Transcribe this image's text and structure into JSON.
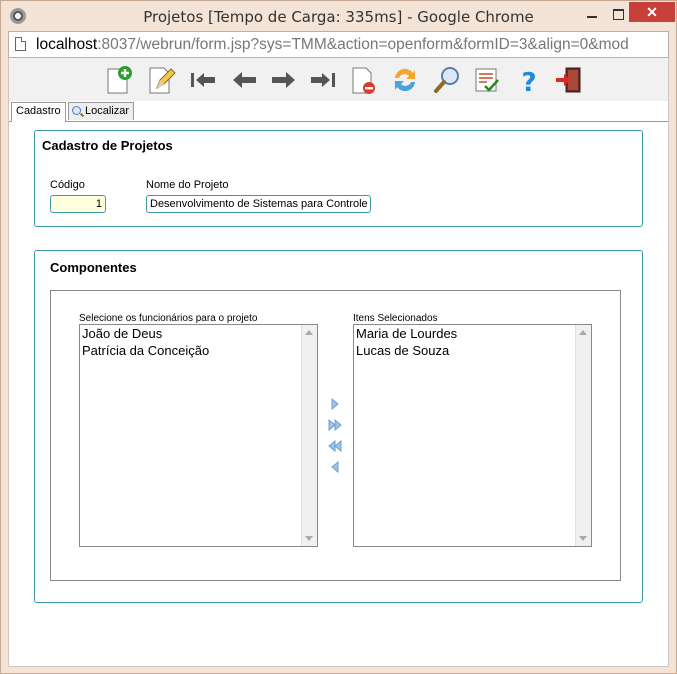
{
  "window": {
    "title": "Projetos [Tempo de Carga: 335ms] - Google Chrome",
    "close_label": "✕"
  },
  "address": {
    "host": "localhost",
    "rest": ":8037/webrun/form.jsp?sys=TMM&action=openform&formID=3&align=0&mod"
  },
  "toolbar": {
    "icons": [
      "new-record-icon",
      "edit-icon",
      "first-record-icon",
      "previous-record-icon",
      "next-record-icon",
      "last-record-icon",
      "delete-icon",
      "refresh-icon",
      "search-icon",
      "report-icon",
      "help-icon",
      "exit-icon"
    ]
  },
  "tabs": {
    "cadastro": "Cadastro",
    "localizar": "Localizar"
  },
  "cadastro": {
    "title": "Cadastro de Projetos",
    "codigo_label": "Código",
    "codigo_value": "1",
    "nome_label": "Nome do Projeto",
    "nome_value": "Desenvolvimento de Sistemas para Controle"
  },
  "componentes": {
    "title": "Componentes",
    "available_label": "Selecione os funcionários para o projeto",
    "available": [
      "João de Deus",
      "Patrícia da Conceição"
    ],
    "selected_label": "Itens Selecionados",
    "selected": [
      "Maria de Lourdes",
      "Lucas de Souza"
    ]
  },
  "colors": {
    "panel_border": "#3a9aa3",
    "codigo_bg": "#ffffdd",
    "close_button": "#c7403a"
  }
}
